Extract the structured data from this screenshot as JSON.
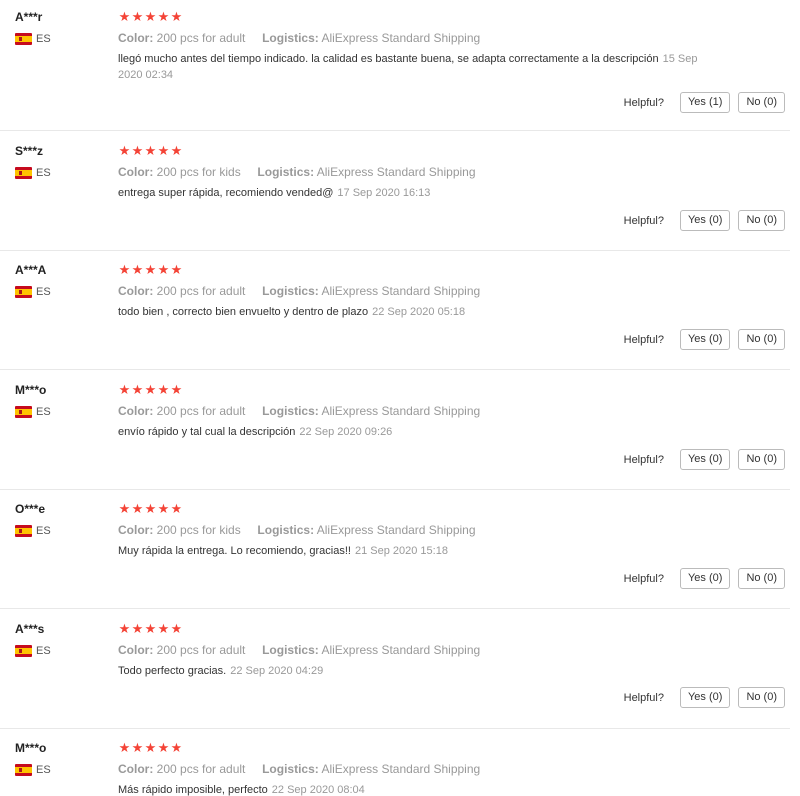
{
  "helpful_label": "Helpful?",
  "colors": {
    "star": "#f44336",
    "muted": "#999999",
    "divider": "#e8e8e8"
  },
  "reviews": [
    {
      "user": "A***r",
      "country": "ES",
      "rating": 5,
      "color_key": "Color:",
      "color_val": "200 pcs for adult",
      "logistics_key": "Logistics:",
      "logistics_val": "AliExpress Standard Shipping",
      "text": "llegó mucho antes del tiempo indicado. la calidad es bastante buena, se adapta correctamente a la descripción",
      "date": "15 Sep 2020 02:34",
      "yes": "Yes (1)",
      "no": "No (0)"
    },
    {
      "user": "S***z",
      "country": "ES",
      "rating": 5,
      "color_key": "Color:",
      "color_val": "200 pcs for kids",
      "logistics_key": "Logistics:",
      "logistics_val": "AliExpress Standard Shipping",
      "text": "entrega super rápida, recomiendo vended@",
      "date": "17 Sep 2020 16:13",
      "yes": "Yes (0)",
      "no": "No (0)"
    },
    {
      "user": "A***A",
      "country": "ES",
      "rating": 5,
      "color_key": "Color:",
      "color_val": "200 pcs for adult",
      "logistics_key": "Logistics:",
      "logistics_val": "AliExpress Standard Shipping",
      "text": "todo bien , correcto bien envuelto y dentro de plazo",
      "date": "22 Sep 2020 05:18",
      "yes": "Yes (0)",
      "no": "No (0)"
    },
    {
      "user": "M***o",
      "country": "ES",
      "rating": 5,
      "color_key": "Color:",
      "color_val": "200 pcs for adult",
      "logistics_key": "Logistics:",
      "logistics_val": "AliExpress Standard Shipping",
      "text": "envío rápido y tal cual la descripción",
      "date": "22 Sep 2020 09:26",
      "yes": "Yes (0)",
      "no": "No (0)"
    },
    {
      "user": "O***e",
      "country": "ES",
      "rating": 4.8,
      "color_key": "Color:",
      "color_val": "200 pcs for kids",
      "logistics_key": "Logistics:",
      "logistics_val": "AliExpress Standard Shipping",
      "text": "Muy rápida la entrega. Lo recomiendo, gracias!!",
      "date": "21 Sep 2020 15:18",
      "yes": "Yes (0)",
      "no": "No (0)"
    },
    {
      "user": "A***s",
      "country": "ES",
      "rating": 4.8,
      "color_key": "Color:",
      "color_val": "200 pcs for adult",
      "logistics_key": "Logistics:",
      "logistics_val": "AliExpress Standard Shipping",
      "text": "Todo perfecto gracias.",
      "date": "22 Sep 2020 04:29",
      "yes": "Yes (0)",
      "no": "No (0)"
    },
    {
      "user": "M***o",
      "country": "ES",
      "rating": 4.8,
      "color_key": "Color:",
      "color_val": "200 pcs for adult",
      "logistics_key": "Logistics:",
      "logistics_val": "AliExpress Standard Shipping",
      "text": "Más rápido imposible, perfecto",
      "date": "22 Sep 2020 08:04",
      "yes": null,
      "no": null
    }
  ]
}
